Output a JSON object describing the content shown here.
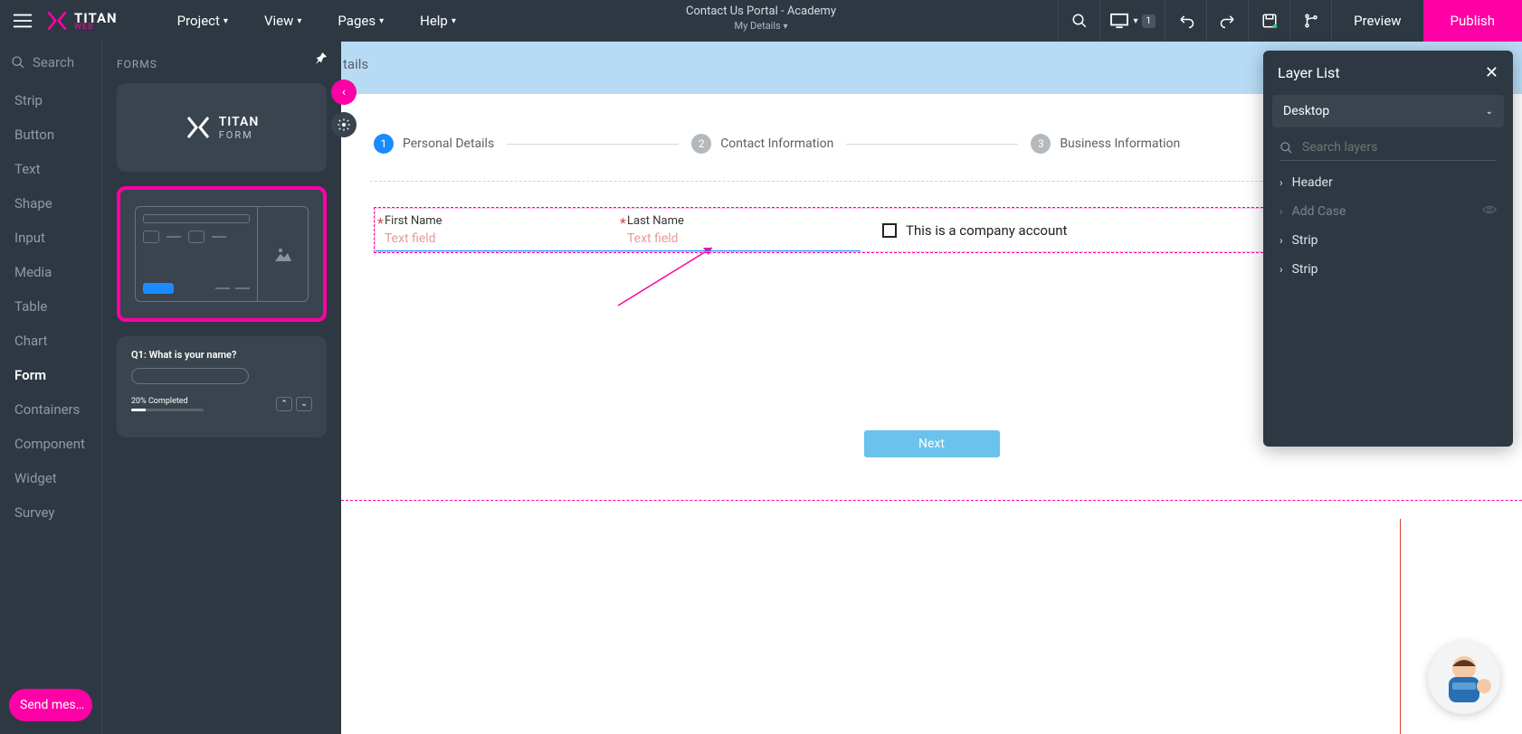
{
  "topbar": {
    "menu": [
      "Project",
      "View",
      "Pages",
      "Help"
    ],
    "title": "Contact Us Portal - Academy",
    "subtitle": "My Details",
    "device_badge": "1",
    "preview": "Preview",
    "publish": "Publish"
  },
  "logo": {
    "name": "TITAN",
    "sub": "WEB"
  },
  "sidebar": {
    "search": "Search",
    "items": [
      "Strip",
      "Button",
      "Text",
      "Shape",
      "Input",
      "Media",
      "Table",
      "Chart",
      "Form",
      "Containers",
      "Component",
      "Widget",
      "Survey"
    ],
    "active_index": 8,
    "send": "Send mes…"
  },
  "forms_panel": {
    "title": "FORMS",
    "titan_form": {
      "name": "TITAN",
      "sub": "FORM"
    },
    "quiz": {
      "question": "Q1: What is your name?",
      "progress": "20% Completed"
    }
  },
  "canvas": {
    "header_tail": "tails",
    "steps": [
      {
        "num": "1",
        "label": "Personal Details"
      },
      {
        "num": "2",
        "label": "Contact Information"
      },
      {
        "num": "3",
        "label": "Business Information"
      }
    ],
    "fields": {
      "first_name": {
        "label": "First Name",
        "placeholder": "Text field"
      },
      "last_name": {
        "label": "Last Name",
        "placeholder": "Text field"
      }
    },
    "checkbox_label": "This is a company account",
    "next": "Next"
  },
  "layer_panel": {
    "title": "Layer List",
    "device": "Desktop",
    "search_placeholder": "Search layers",
    "items": [
      {
        "label": "Header",
        "dim": false
      },
      {
        "label": "Add Case",
        "dim": true,
        "eye": true
      },
      {
        "label": "Strip",
        "dim": false
      },
      {
        "label": "Strip",
        "dim": false
      }
    ]
  }
}
